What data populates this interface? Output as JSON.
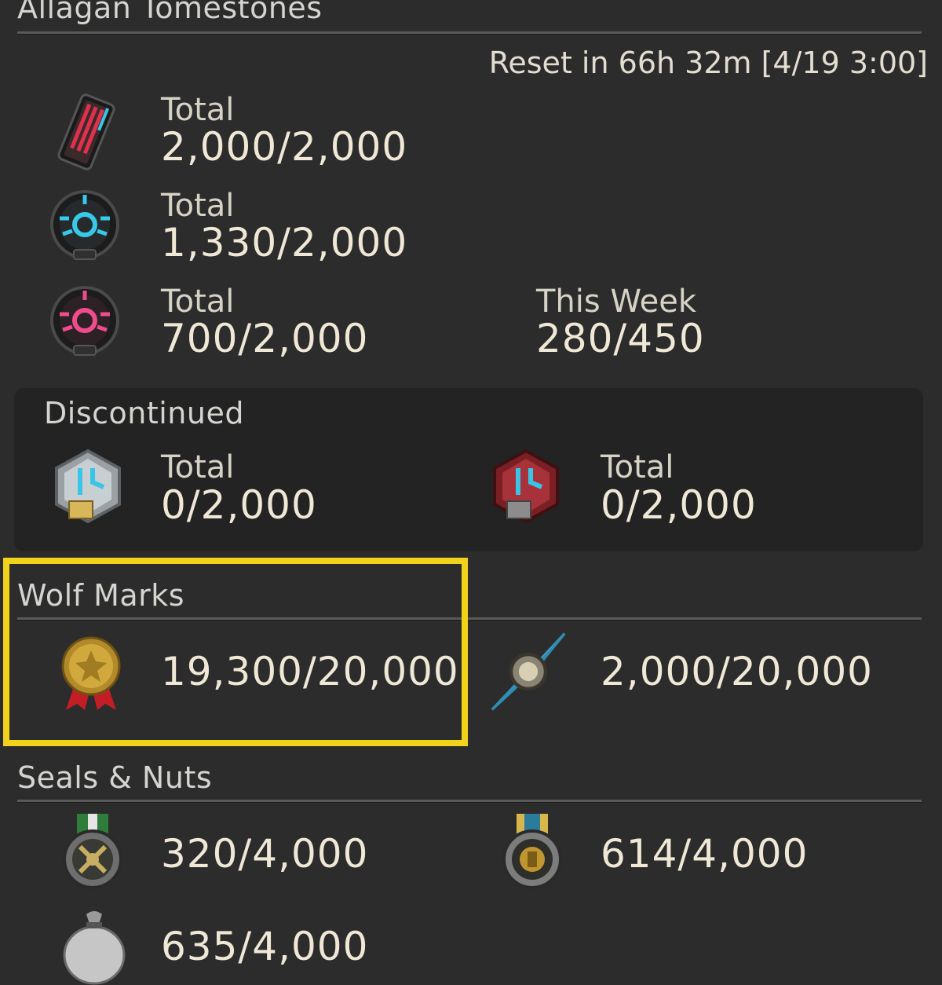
{
  "tomestones": {
    "title": "Allagan Tomestones",
    "reset_text": "Reset in 66h 32m [4/19 3:00]",
    "items": [
      {
        "icon": "red-tomestone-icon",
        "label": "Total",
        "value": "2,000/2,000"
      },
      {
        "icon": "blue-tomestone-icon",
        "label": "Total",
        "value": "1,330/2,000"
      },
      {
        "icon": "pink-tomestone-icon",
        "label": "Total",
        "value": "700/2,000",
        "weekly_label": "This Week",
        "weekly_value": "280/450"
      }
    ]
  },
  "discontinued": {
    "title": "Discontinued",
    "items": [
      {
        "icon": "silver-tomestone-icon",
        "label": "Total",
        "value": "0/2,000"
      },
      {
        "icon": "crimson-tomestone-icon",
        "label": "Total",
        "value": "0/2,000"
      }
    ]
  },
  "wolf_marks": {
    "title": "Wolf Marks",
    "items": [
      {
        "icon": "wolf-mark-medal-icon",
        "value": "19,300/20,000"
      },
      {
        "icon": "trophy-crystal-icon",
        "value": "2,000/20,000"
      }
    ]
  },
  "seals": {
    "title": "Seals & Nuts",
    "items": [
      {
        "icon": "green-ribbon-seal-icon",
        "value": "320/4,000"
      },
      {
        "icon": "blue-ribbon-seal-icon",
        "value": "614/4,000"
      },
      {
        "icon": "nut-pouch-icon",
        "value": "635/4,000"
      }
    ]
  },
  "colors": {
    "background": "#2c2c2c",
    "panel": "#232323",
    "highlight": "#f2d31b",
    "text": "#efe8d6"
  }
}
